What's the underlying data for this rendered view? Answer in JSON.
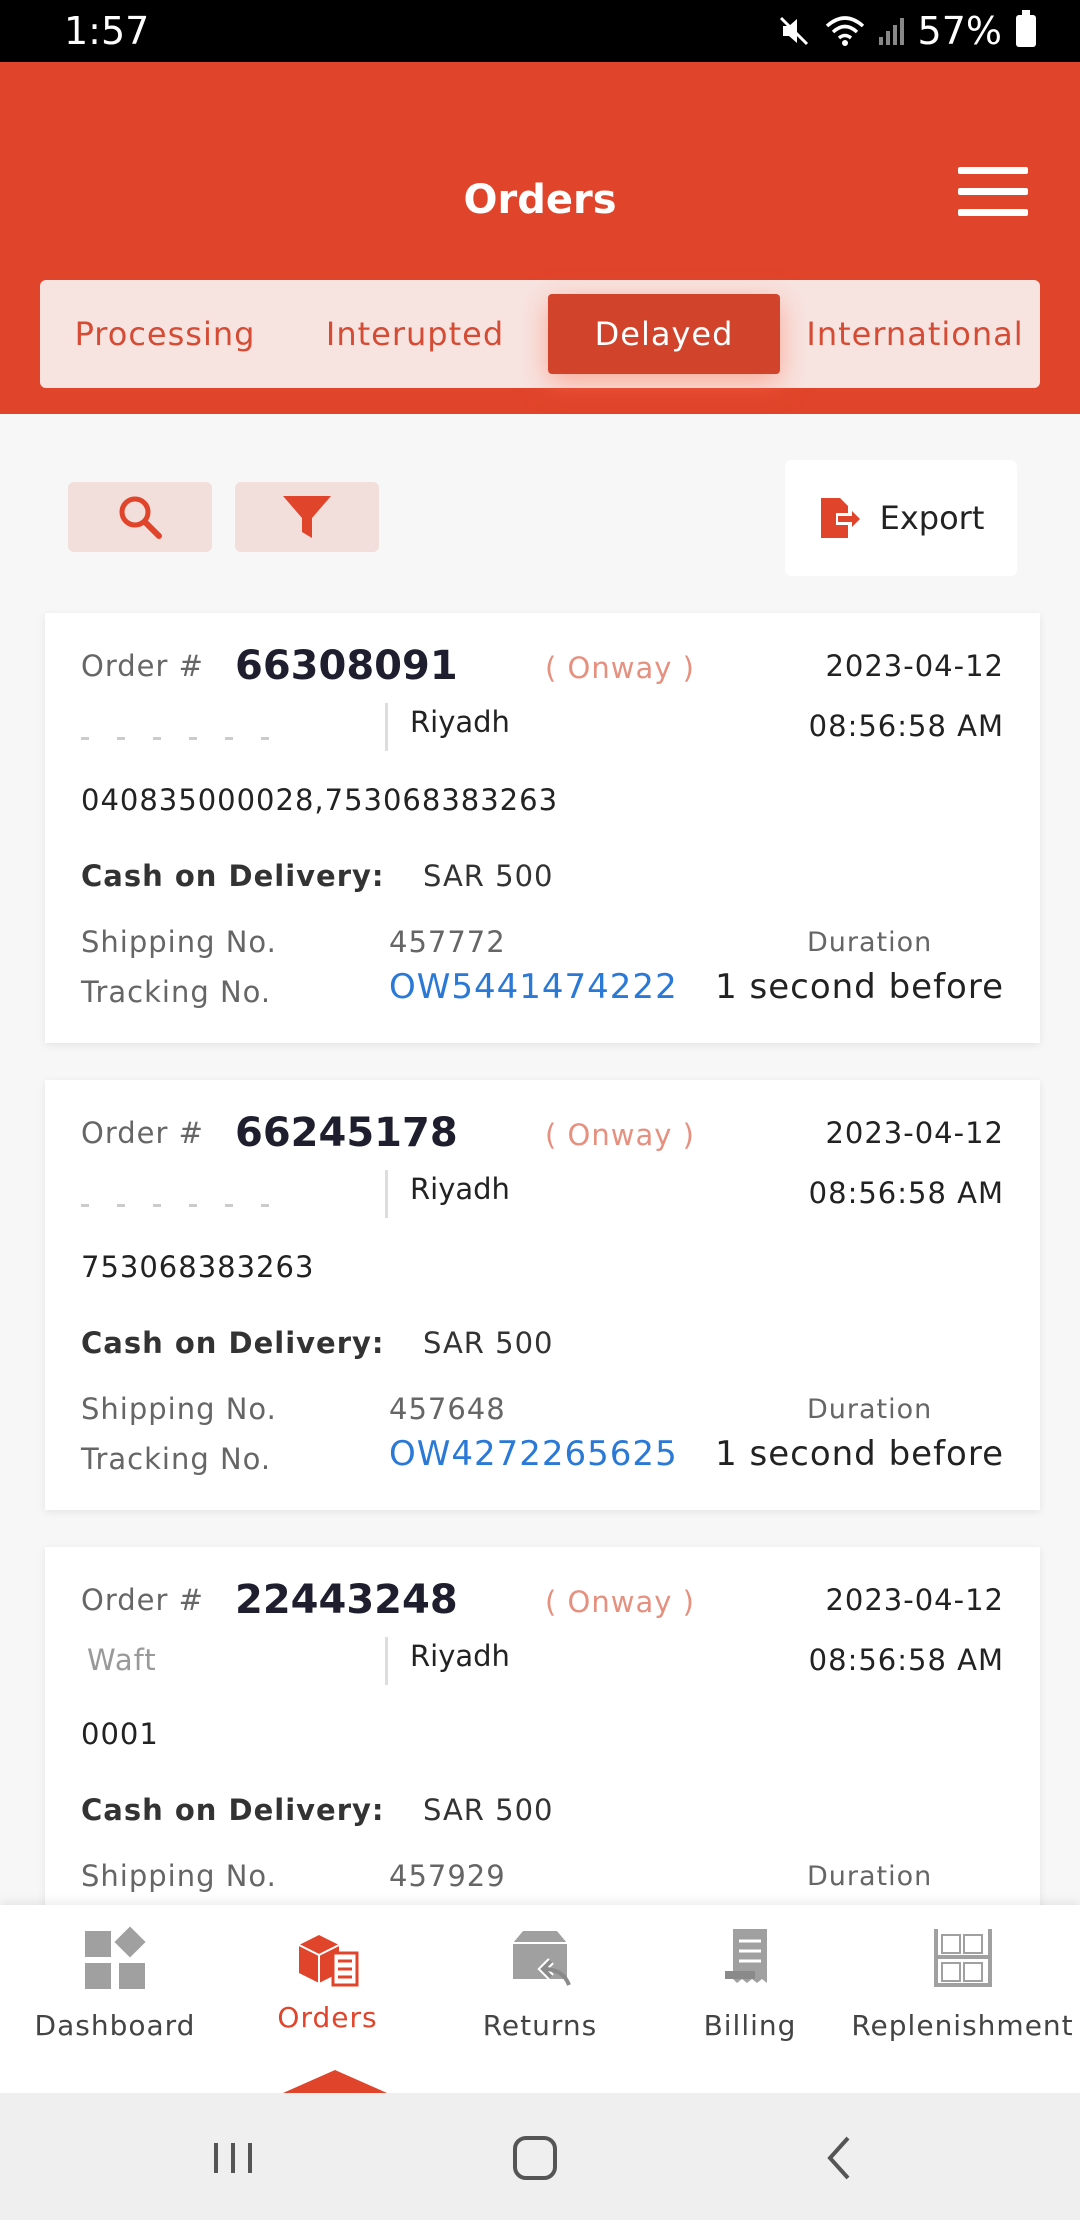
{
  "status_bar": {
    "time": "1:57",
    "battery": "57%"
  },
  "header": {
    "title": "Orders",
    "menu_icon": "hamburger-menu-icon",
    "color": "#e0442a"
  },
  "tabs": [
    {
      "label": "Processing",
      "active": false
    },
    {
      "label": "Interupted",
      "active": false
    },
    {
      "label": "Delayed",
      "active": true
    },
    {
      "label": "International",
      "active": false
    }
  ],
  "toolbar": {
    "search_icon": "search-icon",
    "filter_icon": "filter-icon",
    "export_label": "Export",
    "export_icon": "export-file-icon"
  },
  "orders": [
    {
      "order_label": "Order #",
      "order_number": "66308091",
      "status": "( Onway )",
      "date": "2023-04-12",
      "time": "08:56:58 AM",
      "city": "Riyadh",
      "store": "",
      "barcodes": "040835000028,753068383263",
      "cod_label": "Cash on Delivery:",
      "cod_value": "SAR 500",
      "shipping_label": "Shipping No.",
      "shipping_no": "457772",
      "tracking_label": "Tracking No.",
      "tracking_no": "OW5441474222",
      "duration_label": "Duration",
      "duration": "1 second before"
    },
    {
      "order_label": "Order #",
      "order_number": "66245178",
      "status": "( Onway )",
      "date": "2023-04-12",
      "time": "08:56:58 AM",
      "city": "Riyadh",
      "store": "",
      "barcodes": "753068383263",
      "cod_label": "Cash on Delivery:",
      "cod_value": "SAR 500",
      "shipping_label": "Shipping No.",
      "shipping_no": "457648",
      "tracking_label": "Tracking No.",
      "tracking_no": "OW4272265625",
      "duration_label": "Duration",
      "duration": "1 second before"
    },
    {
      "order_label": "Order #",
      "order_number": "22443248",
      "status": "( Onway )",
      "date": "2023-04-12",
      "time": "08:56:58 AM",
      "city": "Riyadh",
      "store": "Waft",
      "barcodes": "0001",
      "cod_label": "Cash on Delivery:",
      "cod_value": "SAR 500",
      "shipping_label": "Shipping No.",
      "shipping_no": "457929",
      "tracking_label": "Tracking No.",
      "tracking_no": "",
      "duration_label": "Duration",
      "duration": ""
    }
  ],
  "bottom_nav": [
    {
      "label": "Dashboard",
      "icon": "dashboard-icon",
      "active": false
    },
    {
      "label": "Orders",
      "icon": "orders-box-icon",
      "active": true
    },
    {
      "label": "Returns",
      "icon": "returns-box-icon",
      "active": false
    },
    {
      "label": "Billing",
      "icon": "billing-receipt-icon",
      "active": false
    },
    {
      "label": "Replenishment",
      "icon": "warehouse-shelf-icon",
      "active": false
    }
  ],
  "system_nav": {
    "recents_icon": "recents-icon",
    "home_icon": "home-icon",
    "back_icon": "back-icon"
  },
  "colors": {
    "accent": "#e0442a",
    "link": "#2b79d6",
    "status_onway": "#e6907f"
  }
}
